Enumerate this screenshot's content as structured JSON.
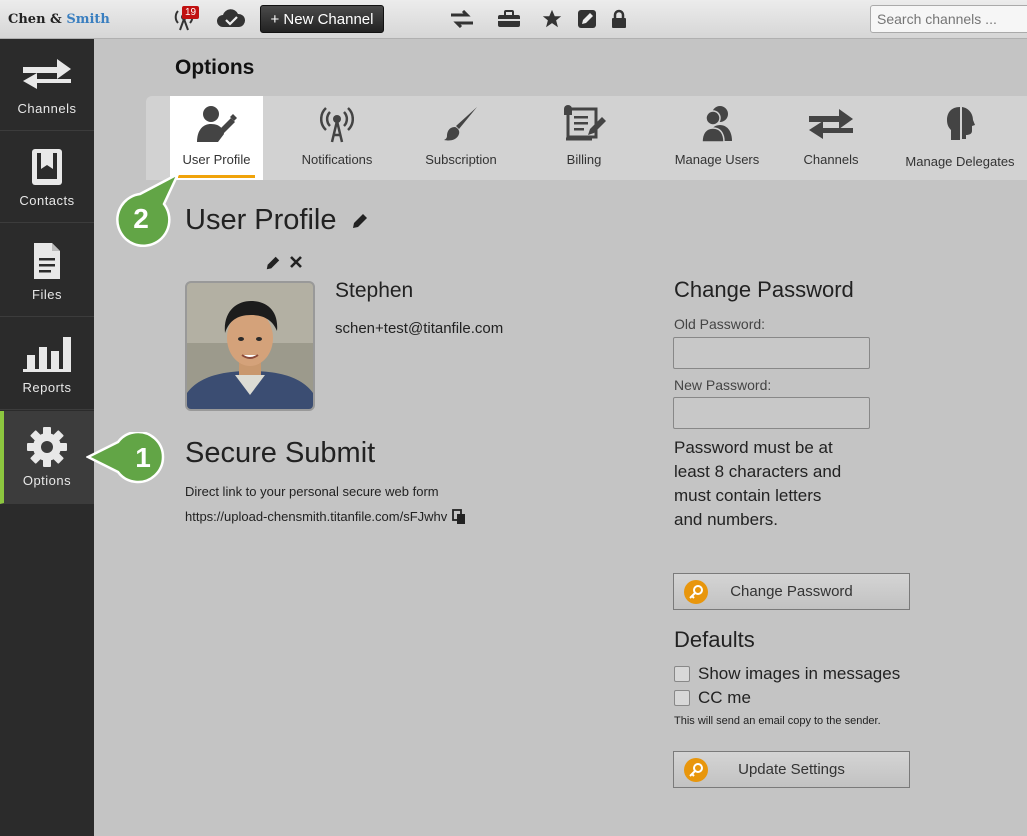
{
  "topbar": {
    "logo_part1": "Chen & ",
    "logo_part2": "Smith",
    "notification_count": "19",
    "new_channel_label": "+ New Channel",
    "search_placeholder": "Search channels ..."
  },
  "sidebar": {
    "items": [
      {
        "label": "Channels",
        "icon": "arrows-exchange-icon"
      },
      {
        "label": "Contacts",
        "icon": "contacts-book-icon"
      },
      {
        "label": "Files",
        "icon": "file-icon"
      },
      {
        "label": "Reports",
        "icon": "bar-chart-icon"
      },
      {
        "label": "Options",
        "icon": "gear-icon",
        "active": true
      }
    ]
  },
  "page": {
    "title": "Options"
  },
  "tabs": [
    {
      "label": "User Profile",
      "active": true
    },
    {
      "label": "Notifications"
    },
    {
      "label": "Subscription"
    },
    {
      "label": "Billing"
    },
    {
      "label": "Manage Users"
    },
    {
      "label": "Channels"
    },
    {
      "label": "Manage Delegates"
    }
  ],
  "profile": {
    "section_title": "User Profile",
    "name": "Stephen",
    "email": "schen+test@titanfile.com"
  },
  "secure_submit": {
    "title": "Secure Submit",
    "description": "Direct link to your personal secure web form",
    "link": "https://upload-chensmith.titanfile.com/sFJwhv"
  },
  "change_password": {
    "title": "Change Password",
    "old_label": "Old Password:",
    "new_label": "New Password:",
    "note": "Password must be at least 8 characters and must contain letters and numbers.",
    "button_label": "Change Password"
  },
  "defaults": {
    "title": "Defaults",
    "show_images_label": "Show images in messages",
    "cc_me_label": "CC me",
    "cc_note": "This will send an email copy to the sender.",
    "button_label": "Update Settings"
  },
  "callouts": {
    "one": "1",
    "two": "2"
  },
  "colors": {
    "accent_green": "#6aa84f",
    "tab_underline": "#f0a30a",
    "key_orange": "#e8960c"
  }
}
